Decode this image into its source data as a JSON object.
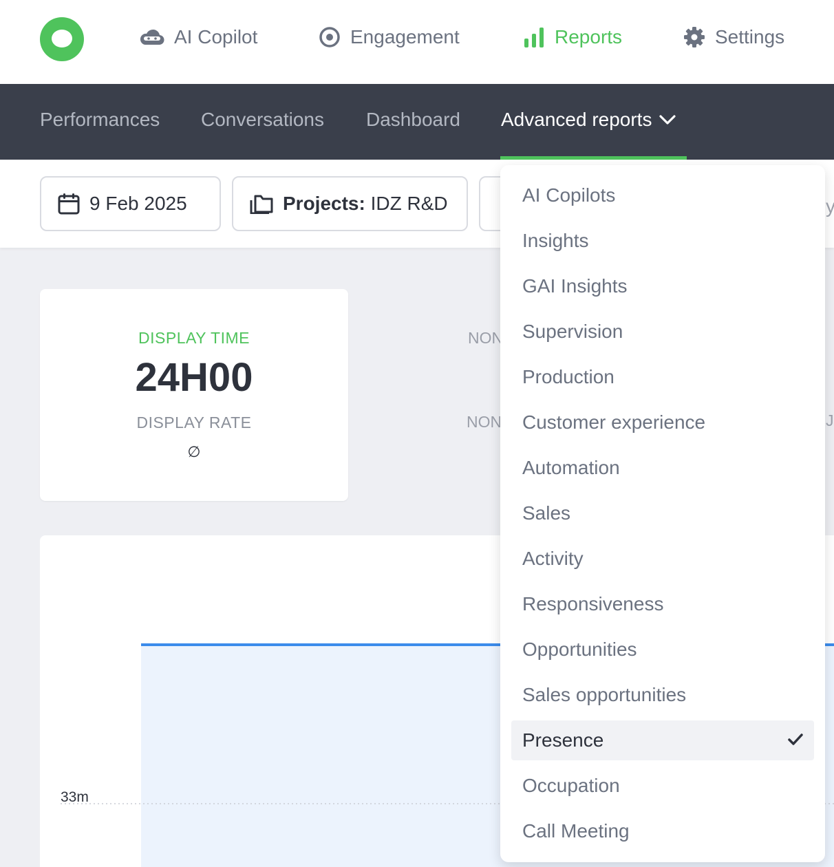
{
  "top_nav": {
    "items": [
      {
        "label": "AI Copilot",
        "icon": "cloud-icon"
      },
      {
        "label": "Engagement",
        "icon": "target-icon"
      },
      {
        "label": "Reports",
        "icon": "bar-chart-icon",
        "active": true
      },
      {
        "label": "Settings",
        "icon": "gear-icon"
      }
    ]
  },
  "sub_nav": {
    "items": [
      {
        "label": "Performances"
      },
      {
        "label": "Conversations"
      },
      {
        "label": "Dashboard"
      },
      {
        "label": "Advanced reports",
        "active": true
      }
    ]
  },
  "filters": {
    "date": "9 Feb 2025",
    "projects_label": "Projects:",
    "projects_value": "IDZ R&D"
  },
  "stat_card": {
    "display_time_label": "DISPLAY TIME",
    "display_time_value": "24H00",
    "display_rate_label": "DISPLAY RATE",
    "display_rate_value": "∅"
  },
  "partial_labels": [
    "NON",
    "NON"
  ],
  "chart_data": {
    "type": "area",
    "y_tick_labels": [
      "33m"
    ],
    "series": [
      {
        "values": [
          1,
          1
        ]
      }
    ]
  },
  "dropdown": {
    "items": [
      {
        "label": "AI Copilots"
      },
      {
        "label": "Insights"
      },
      {
        "label": "GAI Insights"
      },
      {
        "label": "Supervision"
      },
      {
        "label": "Production"
      },
      {
        "label": "Customer experience"
      },
      {
        "label": "Automation"
      },
      {
        "label": "Sales"
      },
      {
        "label": "Activity"
      },
      {
        "label": "Responsiveness"
      },
      {
        "label": "Opportunities"
      },
      {
        "label": "Sales opportunities"
      },
      {
        "label": "Presence",
        "selected": true
      },
      {
        "label": "Occupation"
      },
      {
        "label": "Call Meeting"
      }
    ]
  },
  "colors": {
    "brand_green": "#4fc35c",
    "dark_nav": "#3a3f4b",
    "chart_line": "#3b8beb",
    "chart_fill": "#ecf3fd"
  }
}
